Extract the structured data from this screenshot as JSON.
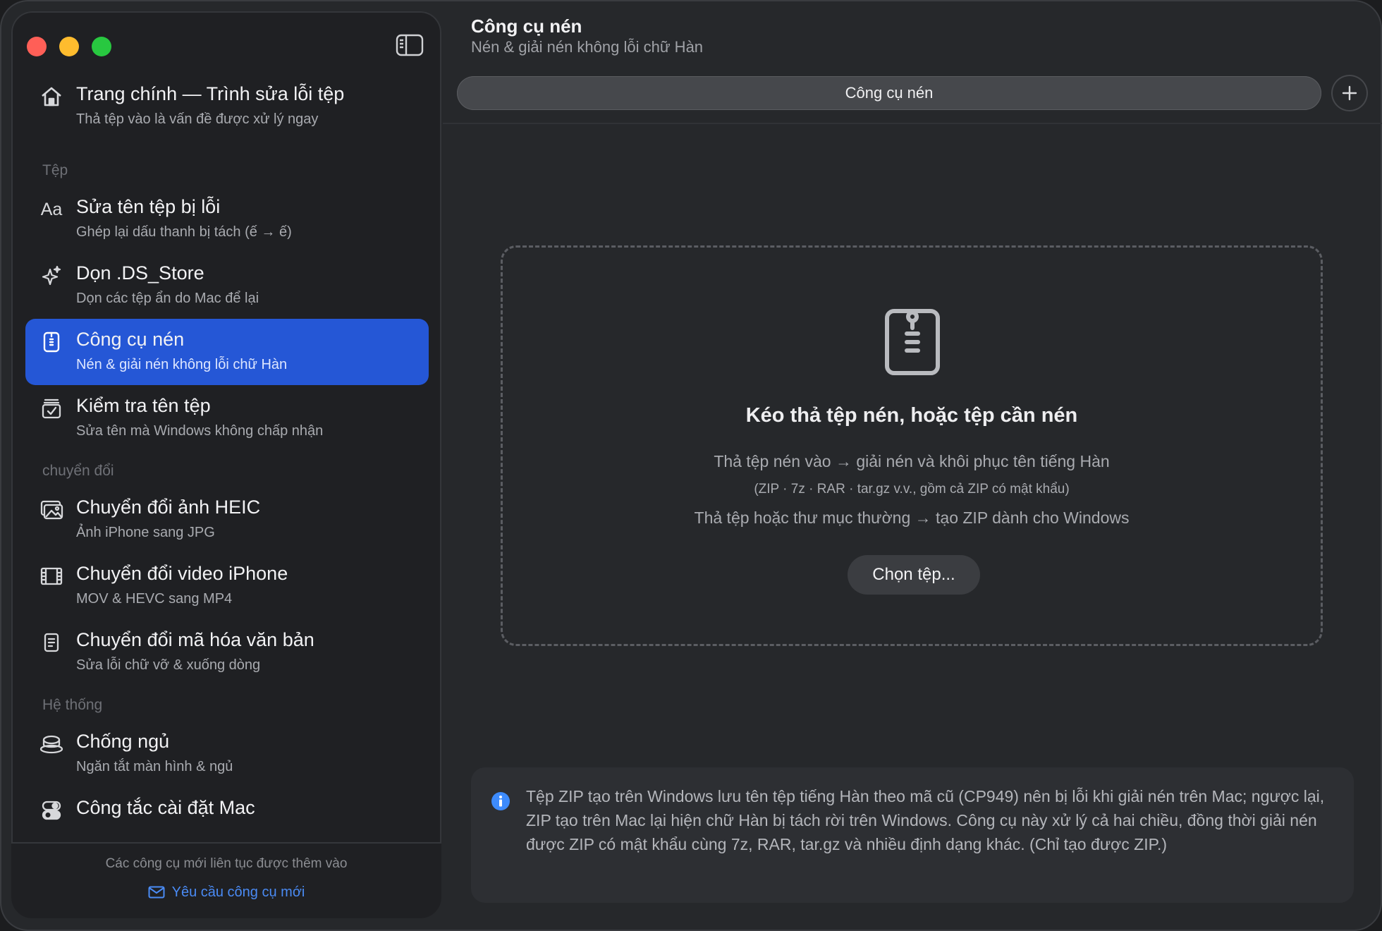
{
  "window": {
    "traffic_lights": [
      "close",
      "minimize",
      "zoom"
    ],
    "colors": {
      "red": "#ff5f57",
      "yellow": "#febc2e",
      "green": "#28c840",
      "accent": "#2557d6"
    }
  },
  "sidebar": {
    "toggle_icon": "sidebar-toggle-icon",
    "home": {
      "title": "Trang chính — Trình sửa lỗi tệp",
      "subtitle": "Thả tệp vào là vấn đề được xử lý ngay",
      "icon": "house-icon"
    },
    "sections": [
      {
        "label": "Tệp",
        "items": [
          {
            "title": "Sửa tên tệp bị lỗi",
            "subtitle": "Ghép lại dấu thanh bị tách (ế → ế)",
            "icon": "text-aa-icon"
          },
          {
            "title": "Dọn .DS_Store",
            "subtitle": "Dọn các tệp ẩn do Mac để lại",
            "icon": "sparkles-icon"
          },
          {
            "title": "Công cụ nén",
            "subtitle": "Nén & giải nén không lỗi chữ Hàn",
            "icon": "zipper-doc-icon",
            "active": true
          },
          {
            "title": "Kiểm tra tên tệp",
            "subtitle": "Sửa tên mà Windows không chấp nhận",
            "icon": "checklist-icon"
          }
        ]
      },
      {
        "label": "chuyển đổi",
        "items": [
          {
            "title": "Chuyển đổi ảnh HEIC",
            "subtitle": "Ảnh iPhone sang JPG",
            "icon": "photos-icon"
          },
          {
            "title": "Chuyển đổi video iPhone",
            "subtitle": "MOV & HEVC sang MP4",
            "icon": "film-icon"
          },
          {
            "title": "Chuyển đổi mã hóa văn bản",
            "subtitle": "Sửa lỗi chữ vỡ & xuống dòng",
            "icon": "document-icon"
          }
        ]
      },
      {
        "label": "Hệ thống",
        "items": [
          {
            "title": "Chống ngủ",
            "subtitle": "Ngăn tắt màn hình & ngủ",
            "icon": "cup-icon"
          },
          {
            "title": "Công tắc cài đặt Mac",
            "subtitle": "",
            "icon": "switches-icon"
          }
        ]
      }
    ],
    "footer": {
      "note": "Các công cụ mới liên tục được thêm vào",
      "link": "Yêu cầu công cụ mới",
      "link_icon": "envelope-icon"
    }
  },
  "main": {
    "title": "Công cụ nén",
    "subtitle": "Nén & giải nén không lỗi chữ Hàn",
    "tab": {
      "label": "Công cụ nén"
    },
    "add_tab_icon": "plus-icon",
    "dropzone": {
      "icon": "zipper-doc-icon",
      "title": "Kéo thả tệp nén, hoặc tệp cần nén",
      "line1": "Thả tệp nén vào → giải nén và khôi phục tên tiếng Hàn",
      "line2": "(ZIP · 7z · RAR · tar.gz v.v., gồm cả ZIP có mật khẩu)",
      "line3": "Thả tệp hoặc thư mục thường → tạo ZIP dành cho Windows",
      "button": "Chọn tệp..."
    },
    "info": {
      "icon": "info-icon",
      "text": "Tệp ZIP tạo trên Windows lưu tên tệp tiếng Hàn theo mã cũ (CP949) nên bị lỗi khi giải nén trên Mac; ngược lại, ZIP tạo trên Mac lại hiện chữ Hàn bị tách rời trên Windows. Công cụ này xử lý cả hai chiều, đồng thời giải nén được ZIP có mật khẩu cùng 7z, RAR, tar.gz và nhiều định dạng khác. (Chỉ tạo được ZIP.)"
    }
  }
}
